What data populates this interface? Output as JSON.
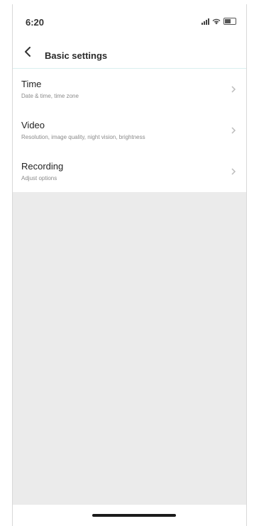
{
  "status_bar": {
    "time": "6:20",
    "icons": [
      "signal-icon",
      "wifi-icon",
      "battery-icon"
    ]
  },
  "nav": {
    "back_icon": "chevron-left-icon",
    "title": "Basic settings"
  },
  "settings": {
    "items": [
      {
        "label": "Time",
        "sublabel": "Date & time, time zone",
        "icon": "chevron-right-icon"
      },
      {
        "label": "Video",
        "sublabel": "Resolution, image quality, night vision, brightness",
        "icon": "chevron-right-icon"
      },
      {
        "label": "Recording",
        "sublabel": "Adjust options",
        "icon": "chevron-right-icon"
      }
    ]
  },
  "colors": {
    "background": "#ebebeb",
    "surface": "#ffffff",
    "divider": "#d9efef"
  }
}
